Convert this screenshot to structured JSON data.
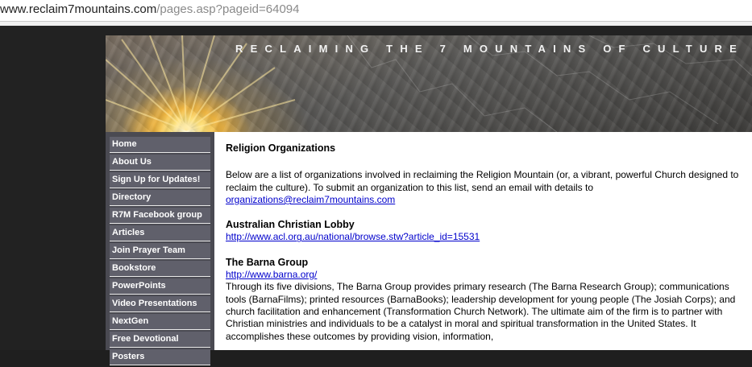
{
  "browser": {
    "url_host": "www.reclaim7mountains.com",
    "url_path": "/pages.asp?pageid=64094"
  },
  "banner": {
    "title": "RECLAIMING THE 7 MOUNTAINS OF CULTURE"
  },
  "nav": {
    "items": [
      {
        "label": "Home"
      },
      {
        "label": "About Us"
      },
      {
        "label": "Sign Up for Updates!"
      },
      {
        "label": "Directory"
      },
      {
        "label": "R7M Facebook group"
      },
      {
        "label": "Articles"
      },
      {
        "label": "Join Prayer Team"
      },
      {
        "label": "Bookstore"
      },
      {
        "label": "PowerPoints"
      },
      {
        "label": "Video Presentations"
      },
      {
        "label": "NextGen"
      },
      {
        "label": "Free Devotional"
      },
      {
        "label": "Posters"
      }
    ]
  },
  "main": {
    "heading": "Religion Organizations",
    "intro": "Below are a list of organizations involved in reclaiming the Religion Mountain (or, a vibrant, powerful Church designed to reclaim the culture). To submit an organization to this list, send an email with details to",
    "email": "organizations@reclaim7mountains.com",
    "orgs": [
      {
        "name": "Australian Christian Lobby",
        "url": "http://www.acl.org.au/national/browse.stw?article_id=15531",
        "description": ""
      },
      {
        "name": "The Barna Group",
        "url": "http://www.barna.org/",
        "description": "Through its five divisions, The Barna Group provides primary research (The Barna Research Group); communications tools (BarnaFilms); printed resources (BarnaBooks); leadership development for young people (The Josiah Corps); and church facilitation and enhancement (Transformation Church Network). The ultimate aim of the firm is to partner with Christian ministries and individuals to be a catalyst in moral and spiritual transformation in the United States. It accomplishes these outcomes by providing vision, information,"
      }
    ]
  },
  "colors": {
    "sidebar_bg": "#4a4a52",
    "nav_item_bg": "#60606b",
    "link": "#0000cc"
  }
}
